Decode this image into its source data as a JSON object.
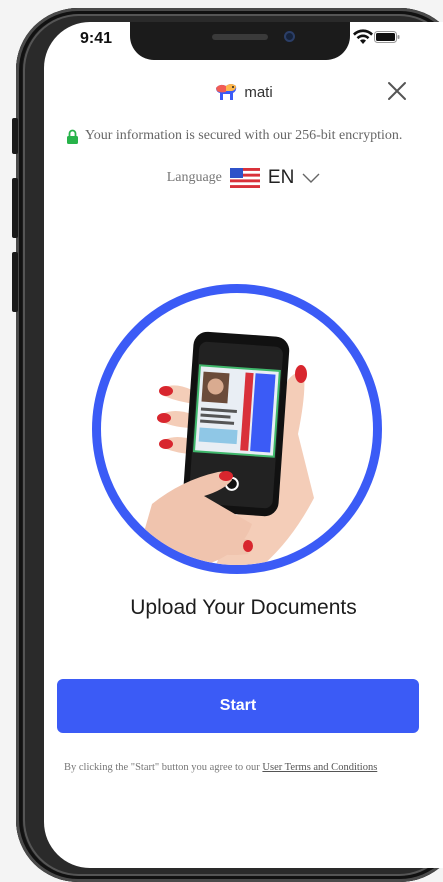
{
  "status_bar": {
    "time": "9:41"
  },
  "brand": {
    "name": "mati"
  },
  "security": {
    "text": "Your information is secured with our 256-bit encryption."
  },
  "language": {
    "label": "Language",
    "value": "EN",
    "flag": "us-flag-icon"
  },
  "main": {
    "title": "Upload Your Documents"
  },
  "actions": {
    "start_label": "Start"
  },
  "terms": {
    "prefix": "By clicking the \"Start\" button you agree to our ",
    "link": "User Terms and Conditions"
  },
  "colors": {
    "accent": "#3b5bf6",
    "lock": "#27b34a"
  }
}
